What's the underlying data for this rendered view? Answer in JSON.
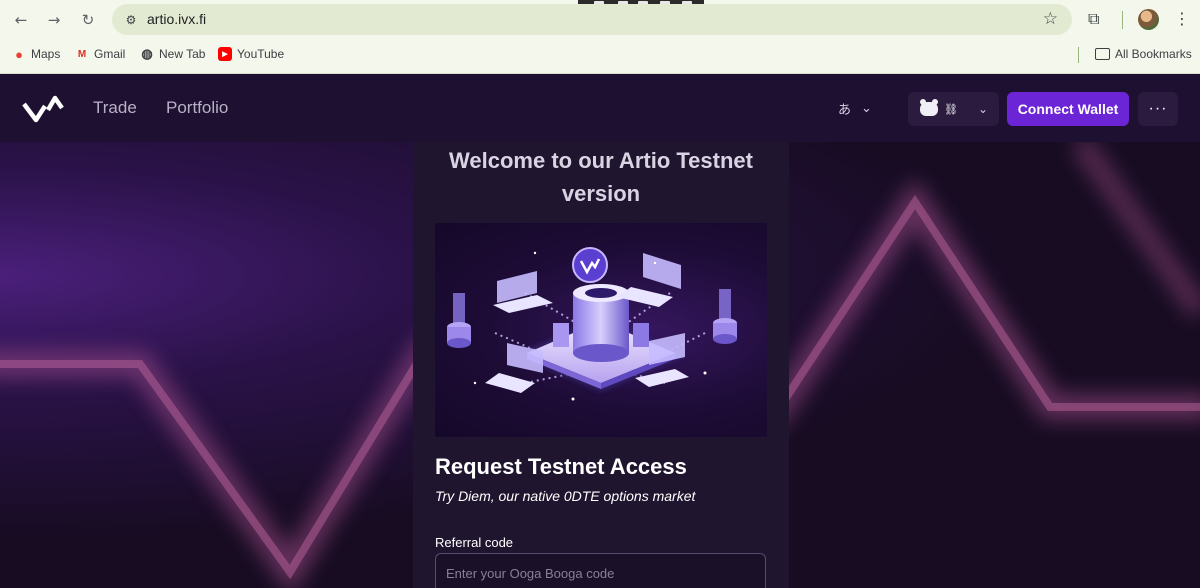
{
  "browser": {
    "url": "artio.ivx.fi",
    "bookmarks": [
      {
        "label": "Maps",
        "icon": "maps-icon"
      },
      {
        "label": "Gmail",
        "icon": "gmail-icon"
      },
      {
        "label": "New Tab",
        "icon": "globe-icon"
      },
      {
        "label": "YouTube",
        "icon": "youtube-icon"
      }
    ],
    "all_bookmarks_label": "All Bookmarks"
  },
  "header": {
    "nav": [
      {
        "label": "Trade"
      },
      {
        "label": "Portfolio"
      }
    ],
    "connect_label": "Connect Wallet",
    "more_label": "···"
  },
  "modal": {
    "title": "Welcome to our Artio Testnet version",
    "request_title": "Request Testnet Access",
    "request_subtitle": "Try Diem, our native 0DTE options market",
    "referral_label": "Referral code",
    "referral_placeholder": "Enter your Ooga Booga code"
  },
  "colors": {
    "accent": "#6b24d6",
    "header_bg": "#1e1030",
    "modal_bg": "#20152f"
  }
}
